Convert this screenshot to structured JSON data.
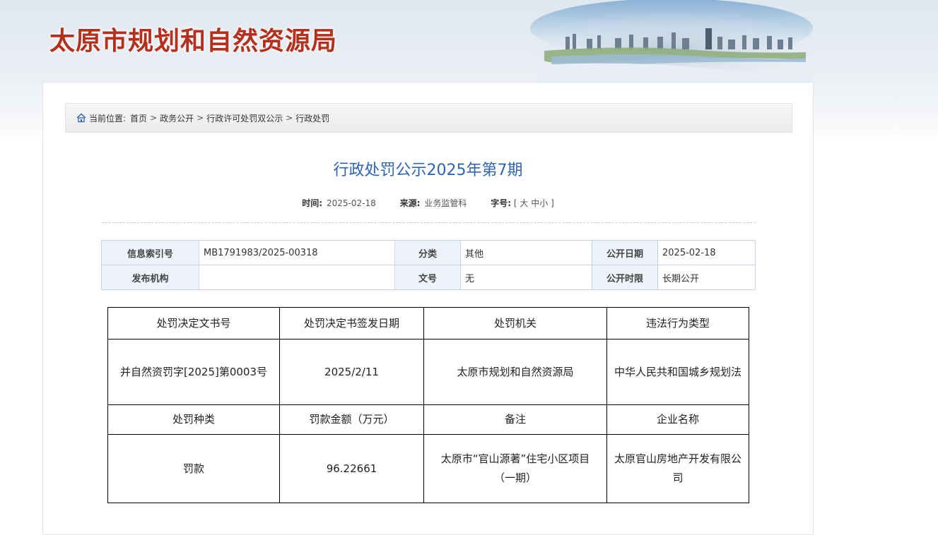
{
  "site": {
    "title": "太原市规划和自然资源局"
  },
  "breadcrumb": {
    "prefix": "当前位置:",
    "items": [
      "首页",
      "政务公开",
      "行政许可处罚双公示",
      "行政处罚"
    ]
  },
  "article": {
    "title": "行政处罚公示2025年第7期",
    "meta": {
      "time_label": "时间:",
      "time_value": "2025-02-18",
      "source_label": "来源:",
      "source_value": "业务监管科",
      "font_label": "字号:",
      "bracket_open": "[",
      "size_large": "大",
      "size_medium": "中",
      "size_small": "小",
      "bracket_close": "]"
    }
  },
  "info_table": {
    "index_label": "信息索引号",
    "index_value": "MB1791983/2025-00318",
    "category_label": "分类",
    "category_value": "其他",
    "pubdate_label": "公开日期",
    "pubdate_value": "2025-02-18",
    "org_label": "发布机构",
    "org_value": "",
    "docno_label": "文号",
    "docno_value": "无",
    "period_label": "公开时限",
    "period_value": "长期公开"
  },
  "penalty_table": {
    "headers1": [
      "处罚决定文书号",
      "处罚决定书签发日期",
      "处罚机关",
      "违法行为类型"
    ],
    "row1": [
      "并自然资罚字[2025]第0003号",
      "2025/2/11",
      "太原市规划和自然资源局",
      "中华人民共和国城乡规划法"
    ],
    "headers2": [
      "处罚种类",
      "罚款金额（万元）",
      "备注",
      "企业名称"
    ],
    "row2": [
      "罚款",
      "96.22661",
      "太原市“官山源著”住宅小区项目（一期）",
      "太原官山房地产开发有限公司"
    ]
  },
  "colors": {
    "title_red": "#b5301c",
    "link_blue": "#2e64b0",
    "label_bg": "#eef2fa"
  },
  "icons": {
    "breadcrumb": "home-icon"
  }
}
